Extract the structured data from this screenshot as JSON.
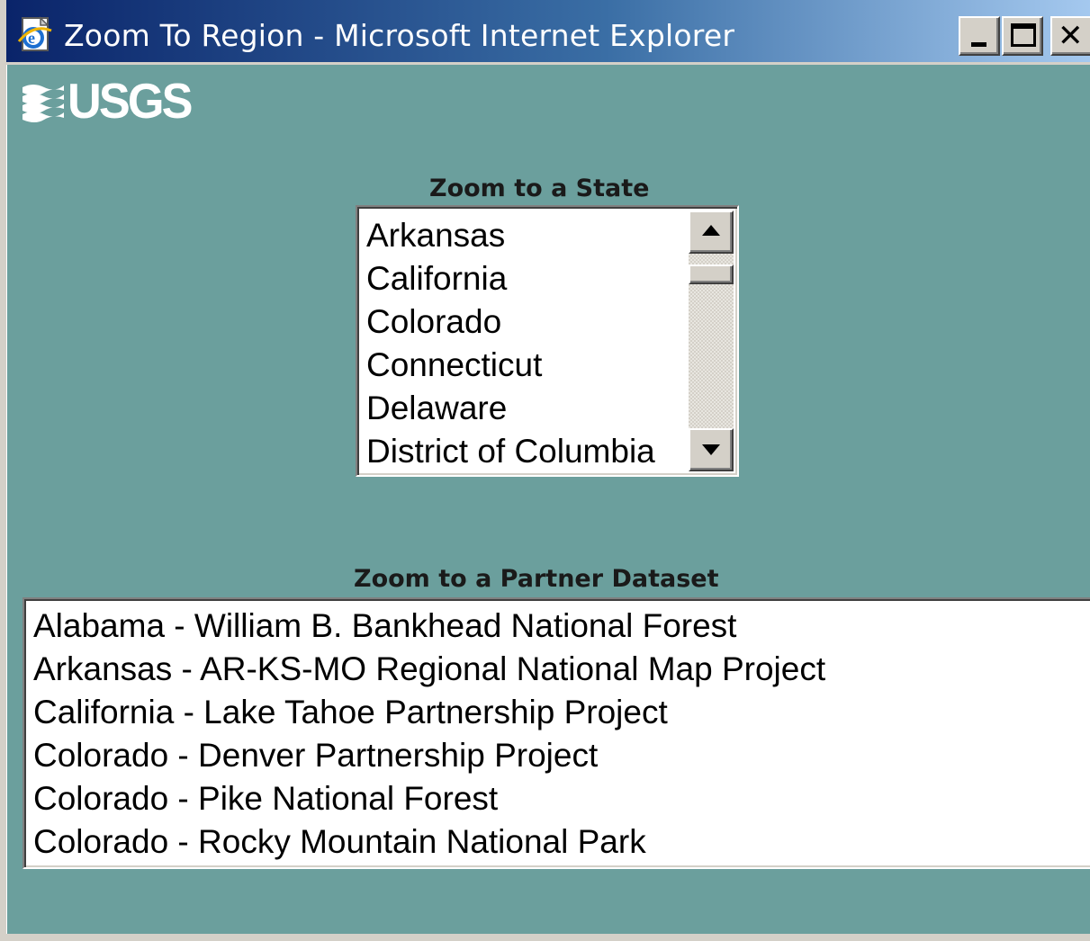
{
  "window": {
    "title": "Zoom To Region - Microsoft Internet Explorer",
    "icon": "ie-page-icon",
    "controls": {
      "minimize": "minimize-icon",
      "maximize": "maximize-icon",
      "close": "close-icon",
      "close_glyph": "✕"
    }
  },
  "header": {
    "logo_text": "USGS"
  },
  "state_section": {
    "label": "Zoom to a State",
    "items": [
      "Arkansas",
      "California",
      "Colorado",
      "Connecticut",
      "Delaware",
      "District of Columbia"
    ]
  },
  "partner_section": {
    "label": "Zoom to a Partner Dataset",
    "items": [
      "Alabama - William B. Bankhead National Forest",
      "Arkansas - AR-KS-MO Regional National Map Project",
      "California - Lake Tahoe Partnership Project",
      "Colorado - Denver Partnership Project",
      "Colorado - Pike National Forest",
      "Colorado - Rocky Mountain National Park"
    ]
  },
  "colors": {
    "page_background": "#6b9f9d",
    "titlebar_start": "#0a246a",
    "titlebar_end": "#a6caf0",
    "chrome": "#d4d0c8"
  }
}
